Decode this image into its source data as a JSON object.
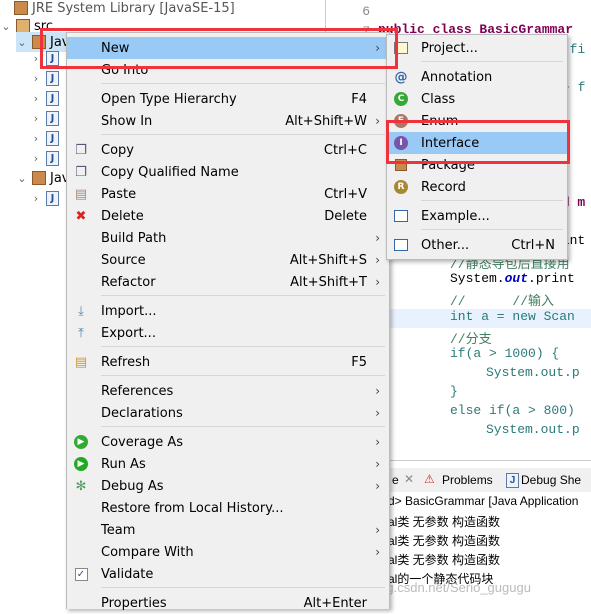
{
  "explorer": {
    "top_item": "JRE System Library [JavaSE-15]",
    "src": "src",
    "pkg1": "Jav",
    "pkg2": "Jav"
  },
  "editor": {
    "lines": [
      "6",
      "7"
    ],
    "code_class": "public class BasicGrammar",
    "frag1": "t fi",
    "frag2": "+ f",
    "frag3": "id m",
    "frag4": "rint",
    "c1": "//静态导包后直接用",
    "c2a": "System.",
    "c2b": "out",
    "c2c": ".print",
    "c3": "//      //输入",
    "c4": "int a = new Scan",
    "c5": "//分支",
    "c6": "if(a > 1000) {",
    "c7": "System.out.p",
    "c8": "}",
    "c9": "else if(a > 800)",
    "c10": "System.out.p"
  },
  "bottom": {
    "tabs": [
      "e",
      "Problems",
      "Debug She"
    ],
    "console_header": "d> BasicGrammar [Java Application",
    "output": [
      "al类  无参数  构造函数",
      "al类  无参数  构造函数",
      "al类  无参数  构造函数",
      "al的一个静态代码块"
    ]
  },
  "watermark": "https://blog.csdn.net/Serio_gugugu",
  "menu": {
    "items": [
      {
        "label": "New",
        "submenu": true,
        "selected": true
      },
      {
        "label": "Go Into"
      },
      {
        "label": "Open Type Hierarchy",
        "shortcut": "F4"
      },
      {
        "label": "Show In",
        "shortcut": "Alt+Shift+W",
        "submenu": true
      },
      {
        "label": "Copy",
        "shortcut": "Ctrl+C",
        "icon": "copy-icon"
      },
      {
        "label": "Copy Qualified Name",
        "icon": "copy-qualified-icon"
      },
      {
        "label": "Paste",
        "shortcut": "Ctrl+V",
        "icon": "paste-icon"
      },
      {
        "label": "Delete",
        "shortcut": "Delete",
        "icon": "delete-icon"
      },
      {
        "label": "Build Path",
        "submenu": true
      },
      {
        "label": "Source",
        "shortcut": "Alt+Shift+S",
        "submenu": true
      },
      {
        "label": "Refactor",
        "shortcut": "Alt+Shift+T",
        "submenu": true
      },
      {
        "label": "Import...",
        "icon": "import-icon"
      },
      {
        "label": "Export...",
        "icon": "export-icon"
      },
      {
        "label": "Refresh",
        "shortcut": "F5",
        "icon": "refresh-icon"
      },
      {
        "label": "References",
        "submenu": true
      },
      {
        "label": "Declarations",
        "submenu": true
      },
      {
        "label": "Coverage As",
        "submenu": true,
        "icon": "coverage-icon"
      },
      {
        "label": "Run As",
        "submenu": true,
        "icon": "run-icon"
      },
      {
        "label": "Debug As",
        "submenu": true,
        "icon": "debug-icon"
      },
      {
        "label": "Restore from Local History..."
      },
      {
        "label": "Team",
        "submenu": true
      },
      {
        "label": "Compare With",
        "submenu": true
      },
      {
        "label": "Validate",
        "icon": "validate-checkbox-icon"
      },
      {
        "label": "Properties",
        "shortcut": "Alt+Enter"
      }
    ]
  },
  "submenu": {
    "items": [
      {
        "label": "Project...",
        "icon": "project-icon"
      },
      {
        "label": "Annotation",
        "icon": "annotation-icon"
      },
      {
        "label": "Class",
        "icon": "class-icon"
      },
      {
        "label": "Enum",
        "icon": "enum-icon"
      },
      {
        "label": "Interface",
        "icon": "interface-icon",
        "selected": true
      },
      {
        "label": "Package",
        "icon": "package-icon"
      },
      {
        "label": "Record",
        "icon": "record-icon"
      },
      {
        "label": "Example...",
        "icon": "example-icon"
      },
      {
        "label": "Other...",
        "shortcut": "Ctrl+N",
        "icon": "wizard-icon"
      }
    ]
  },
  "colors": {
    "selection": "#99c9f5",
    "highlight_box": "#f0323c",
    "menu_bg": "#f0f0f0"
  }
}
